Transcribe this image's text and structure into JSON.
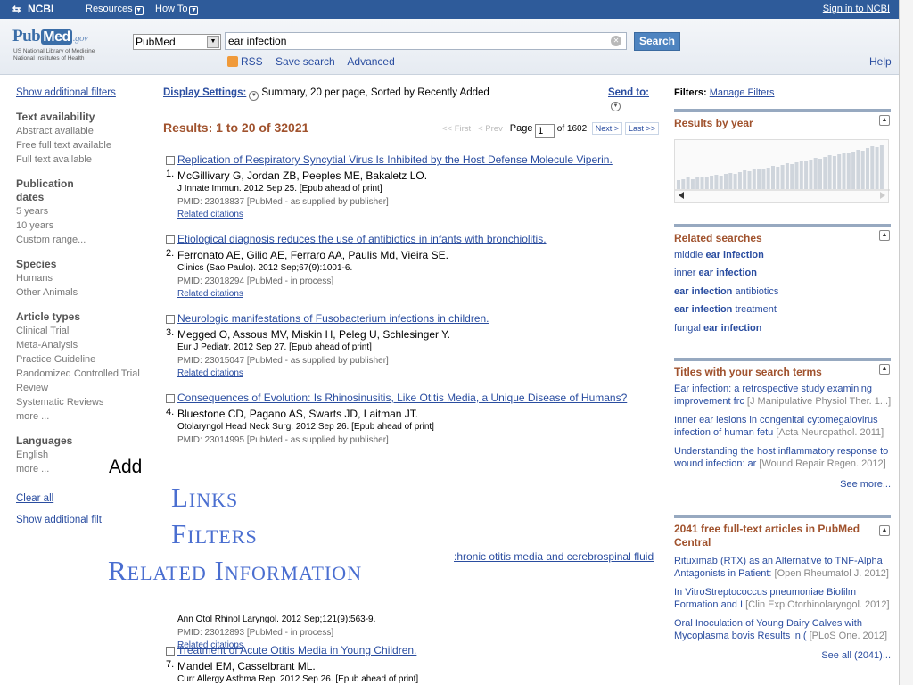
{
  "ncbi_bar": {
    "logo": "NCBI",
    "resources": "Resources",
    "howto": "How To",
    "signin": "Sign in to NCBI"
  },
  "header": {
    "logo_pub": "Pub",
    "logo_med": "Med",
    "logo_gov": ".gov",
    "sub1": "US National Library of Medicine",
    "sub2": "National Institutes of Health",
    "db": "PubMed",
    "query": "ear infection",
    "search_btn": "Search",
    "rss": "RSS",
    "save_search": "Save search",
    "advanced": "Advanced",
    "help": "Help"
  },
  "left": {
    "show_filters": "Show additional filters",
    "groups": [
      {
        "head": "Text availability",
        "items": [
          "Abstract available",
          "Free full text available",
          "Full text available"
        ]
      },
      {
        "head": "Publication dates",
        "items": [
          "5 years",
          "10 years",
          "Custom range..."
        ]
      },
      {
        "head": "Species",
        "items": [
          "Humans",
          "Other Animals"
        ]
      },
      {
        "head": "Article types",
        "items": [
          "Clinical Trial",
          "Meta-Analysis",
          "Practice Guideline",
          "Randomized Controlled Trial",
          "Review",
          "Systematic Reviews",
          "more ..."
        ]
      },
      {
        "head": "Languages",
        "items": [
          "English",
          "more ..."
        ]
      }
    ],
    "clear_all": "Clear all",
    "show_filters_bottom": "Show additional filt"
  },
  "center": {
    "display_settings": "Display Settings:",
    "display_value": "Summary, 20 per page, Sorted by Recently Added",
    "send_to": "Send to:",
    "results_count": "Results: 1 to 20 of 32021",
    "pager": {
      "first": "<< First",
      "prev": "< Prev",
      "page_label": "Page",
      "page_value": "1",
      "of": "of 1602",
      "next": "Next >",
      "last": "Last >>"
    },
    "results": [
      {
        "num": "1.",
        "title": "Replication of Respiratory Syncytial Virus Is Inhibited by the Host Defense Molecule Viperin.",
        "authors": "McGillivary G, Jordan ZB, Peeples ME, Bakaletz LO.",
        "journal": "J Innate Immun. 2012 Sep 25. [Epub ahead of print]",
        "pmid": "PMID: 23018837 [PubMed - as supplied by publisher]",
        "related": "Related citations"
      },
      {
        "num": "2.",
        "title": "Etiological diagnosis reduces the use of antibiotics in infants with bronchiolitis.",
        "authors": "Ferronato AE, Gilio AE, Ferraro AA, Paulis Md, Vieira SE.",
        "journal": "Clinics (Sao Paulo). 2012 Sep;67(9):1001-6.",
        "pmid": "PMID: 23018294 [PubMed - in process]",
        "related": "Related citations"
      },
      {
        "num": "3.",
        "title": "Neurologic manifestations of Fusobacterium infections in children.",
        "authors": "Megged O, Assous MV, Miskin H, Peleg U, Schlesinger Y.",
        "journal": "Eur J Pediatr. 2012 Sep 27. [Epub ahead of print]",
        "pmid": "PMID: 23015047 [PubMed - as supplied by publisher]",
        "related": "Related citations"
      },
      {
        "num": "4.",
        "title": "Consequences of Evolution: Is Rhinosinusitis, Like Otitis Media, a Unique Disease of Humans?",
        "authors": "Bluestone CD, Pagano AS, Swarts JD, Laitman JT.",
        "journal": "Otolaryngol Head Neck Surg. 2012 Sep 26. [Epub ahead of print]",
        "pmid": "PMID: 23014995 [PubMed - as supplied by publisher]",
        "related": ""
      },
      {
        "num": "",
        "title": "",
        "authors": "",
        "journal": "Ann Otol Rhinol Laryngol. 2012 Sep;121(9):563-9.",
        "pmid": "PMID: 23012893 [PubMed - in process]",
        "related": "Related citations"
      },
      {
        "num": "7.",
        "title": "Treatment of Acute Otitis Media in Young Children.",
        "authors": "Mandel EM, Casselbrant ML.",
        "journal": "Curr Allergy Asthma Rep. 2012 Sep 26. [Epub ahead of print]",
        "pmid": "",
        "related": ""
      }
    ],
    "partial_title": ":hronic otitis media and cerebrospinal fluid"
  },
  "right": {
    "filters_label": "Filters:",
    "manage_filters": "Manage Filters",
    "results_by_year": "Results by year",
    "related_searches_head": "Related searches",
    "related_searches": [
      {
        "pre": "middle ",
        "bold": "ear infection",
        "post": ""
      },
      {
        "pre": "inner ",
        "bold": "ear infection",
        "post": ""
      },
      {
        "pre": "",
        "bold": "ear infection",
        "post": " antibiotics"
      },
      {
        "pre": "",
        "bold": "ear infection",
        "post": " treatment"
      },
      {
        "pre": "fungal ",
        "bold": "ear infection",
        "post": ""
      }
    ],
    "titles_head": "Titles with your search terms",
    "titles": [
      {
        "l1": "Ear infection: a retrospective study examining",
        "l2": "improvement frc",
        "src": "[J Manipulative Physiol Ther. 1...]"
      },
      {
        "l1": "Inner ear lesions in congenital cytomegalovirus",
        "l2": "infection of human fetu",
        "src": "[Acta Neuropathol. 2011]"
      },
      {
        "l1": "Understanding the host inflammatory response to",
        "l2": "wound infection: ar",
        "src": "[Wound Repair Regen. 2012]"
      }
    ],
    "see_more": "See more...",
    "free_head": "2041 free full-text articles in PubMed Central",
    "free_items": [
      {
        "l1": "Rituximab (RTX) as an Alternative to TNF-Alpha",
        "l2": "Antagonists in Patient:",
        "src": "[Open Rheumatol J. 2012]"
      },
      {
        "l1": "In VitroStreptococcus pneumoniae Biofilm",
        "l2": "Formation and I",
        "src": "[Clin Exp Otorhinolaryngol. 2012]"
      },
      {
        "l1": "Oral Inoculation of Young Dairy Calves with",
        "l2": "Mycoplasma bovis Results in (",
        "src": "[PLoS One. 2012]"
      }
    ],
    "see_all": "See all (2041)..."
  },
  "overlay": {
    "add": "Add",
    "links": "Links",
    "filters": "Filters",
    "related_information": "Related Information"
  }
}
